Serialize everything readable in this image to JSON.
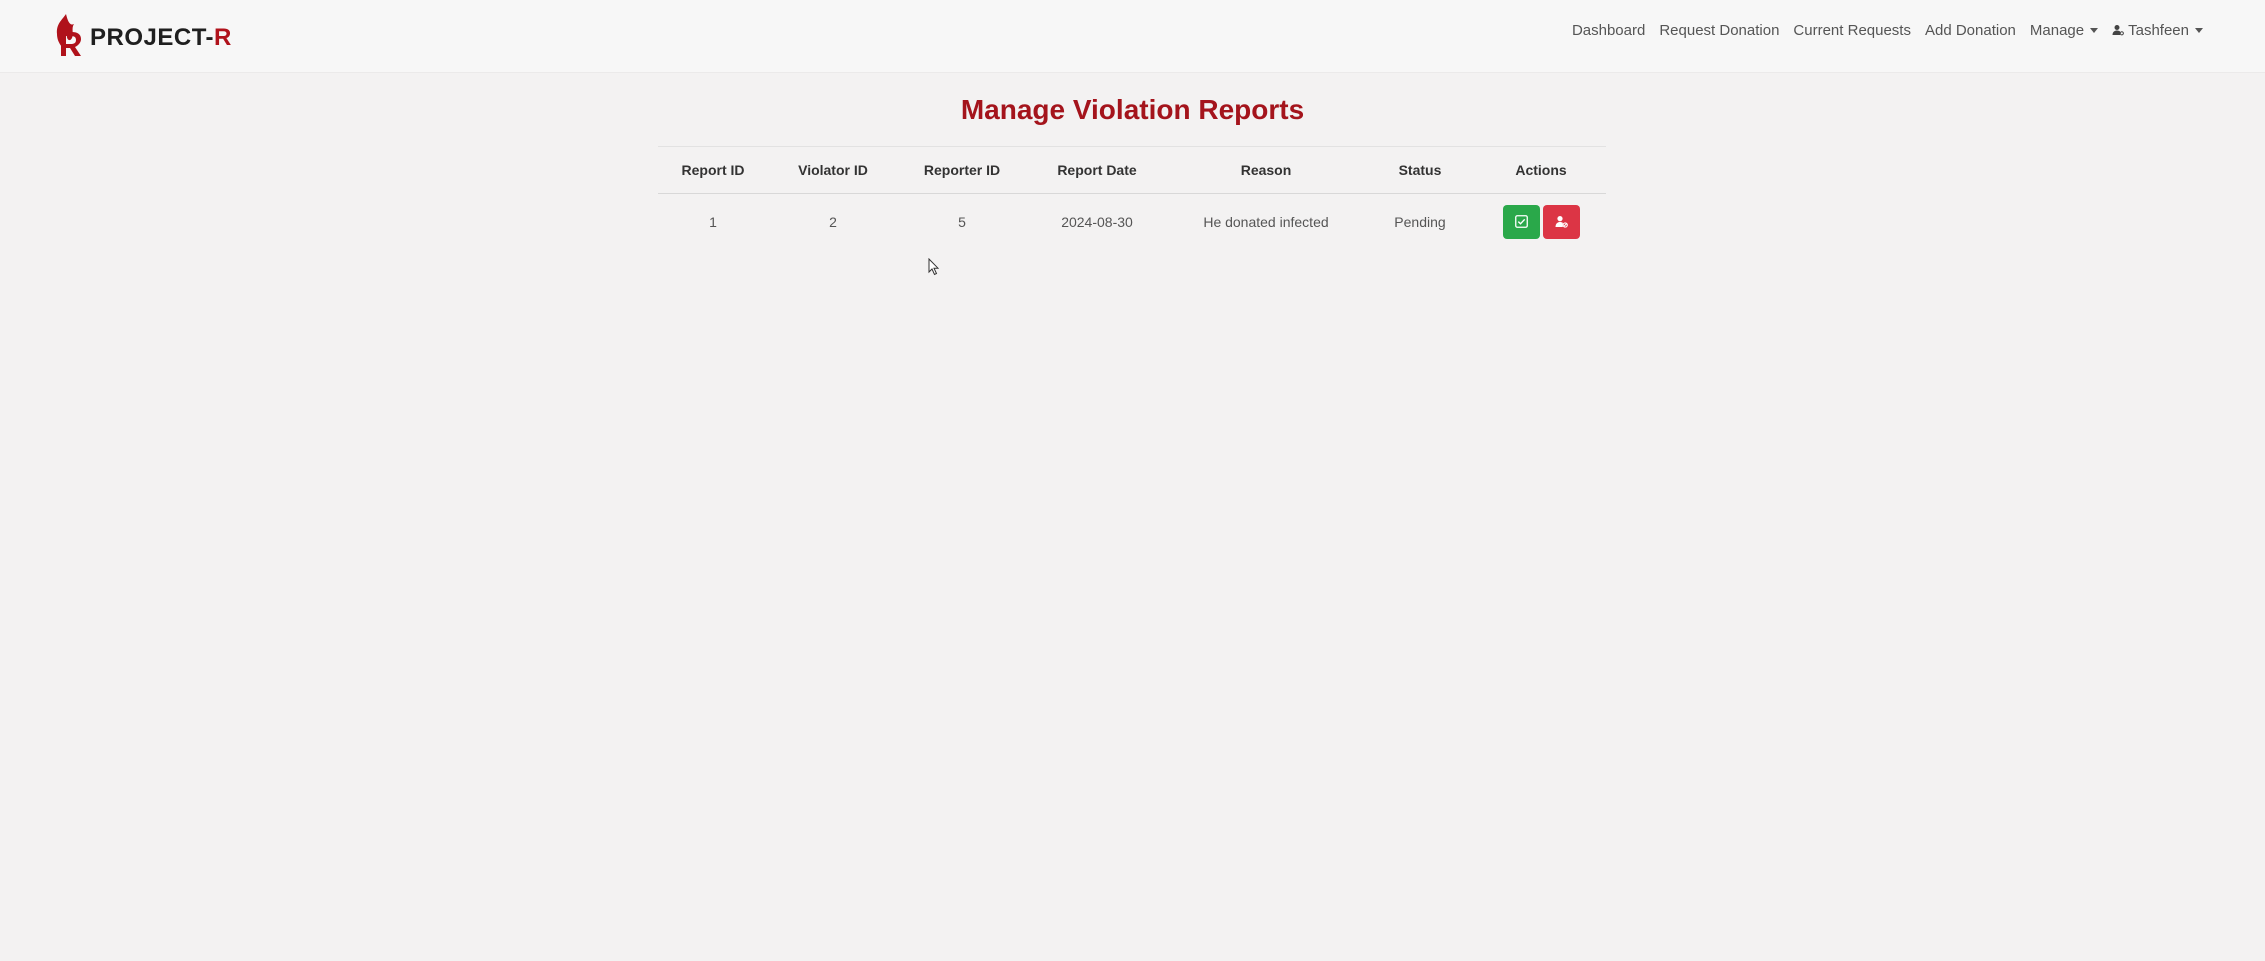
{
  "brand": {
    "name_prefix": "PROJECT-",
    "name_suffix": "R",
    "logo_icon": "flame-r-logo",
    "accent_color": "#b0121b"
  },
  "nav": {
    "dashboard": "Dashboard",
    "request_donation": "Request Donation",
    "current_requests": "Current Requests",
    "add_donation": "Add Donation",
    "manage": "Manage",
    "user": "Tashfeen"
  },
  "page": {
    "title": "Manage Violation Reports",
    "title_color": "#a4141c"
  },
  "table": {
    "headers": [
      "Report ID",
      "Violator ID",
      "Reporter ID",
      "Report Date",
      "Reason",
      "Status",
      "Actions"
    ],
    "rows": [
      {
        "report_id": "1",
        "violator_id": "2",
        "reporter_id": "5",
        "report_date": "2024-08-30",
        "reason": "He donated infected",
        "status": "Pending",
        "actions": [
          {
            "icon": "check-square-icon",
            "color": "#2aa84a"
          },
          {
            "icon": "user-ban-icon",
            "color": "#dc3545"
          }
        ]
      }
    ]
  }
}
